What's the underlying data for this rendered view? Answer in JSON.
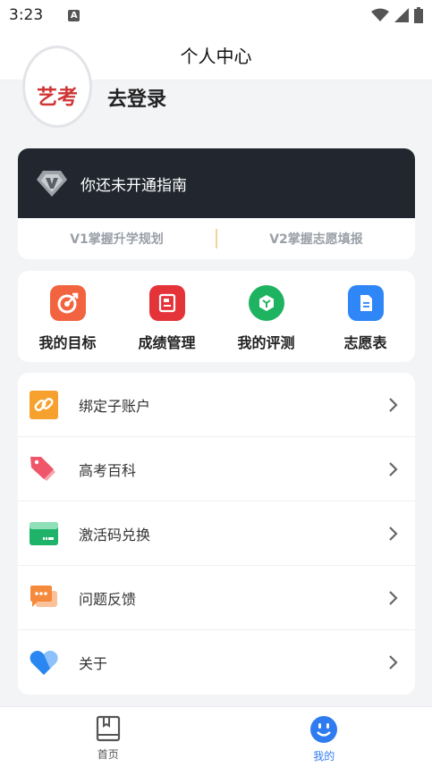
{
  "status_bar": {
    "time": "3:23",
    "notification_badge": "A"
  },
  "header": {
    "title": "个人中心"
  },
  "profile": {
    "avatar_text": "艺考",
    "login_label": "去登录"
  },
  "vip": {
    "banner_text": "你还未开通指南",
    "items": [
      {
        "label": "V1掌握升学规划"
      },
      {
        "label": "V2掌握志愿填报"
      }
    ]
  },
  "shortcuts": [
    {
      "label": "我的目标",
      "icon": "target-icon",
      "color": "#f2643f"
    },
    {
      "label": "成绩管理",
      "icon": "score-report-icon",
      "color": "#e5333a"
    },
    {
      "label": "我的评测",
      "icon": "assessment-icon",
      "color": "#1db360"
    },
    {
      "label": "志愿表",
      "icon": "document-icon",
      "color": "#2f86f6"
    }
  ],
  "menu": [
    {
      "label": "绑定子账户",
      "icon": "link-icon",
      "color": "#f6a02d"
    },
    {
      "label": "高考百科",
      "icon": "tag-icon",
      "color": "#f0566a"
    },
    {
      "label": "激活码兑换",
      "icon": "card-icon",
      "color": "#1fb36a"
    },
    {
      "label": "问题反馈",
      "icon": "chat-icon",
      "color": "#f58a3c"
    },
    {
      "label": "关于",
      "icon": "heart-icon",
      "color": "#2a86f0"
    }
  ],
  "bottom_nav": [
    {
      "label": "首页",
      "icon": "book-icon",
      "active": false,
      "color": "#555555"
    },
    {
      "label": "我的",
      "icon": "smiley-icon",
      "active": true,
      "color": "#2f7cf0"
    }
  ]
}
